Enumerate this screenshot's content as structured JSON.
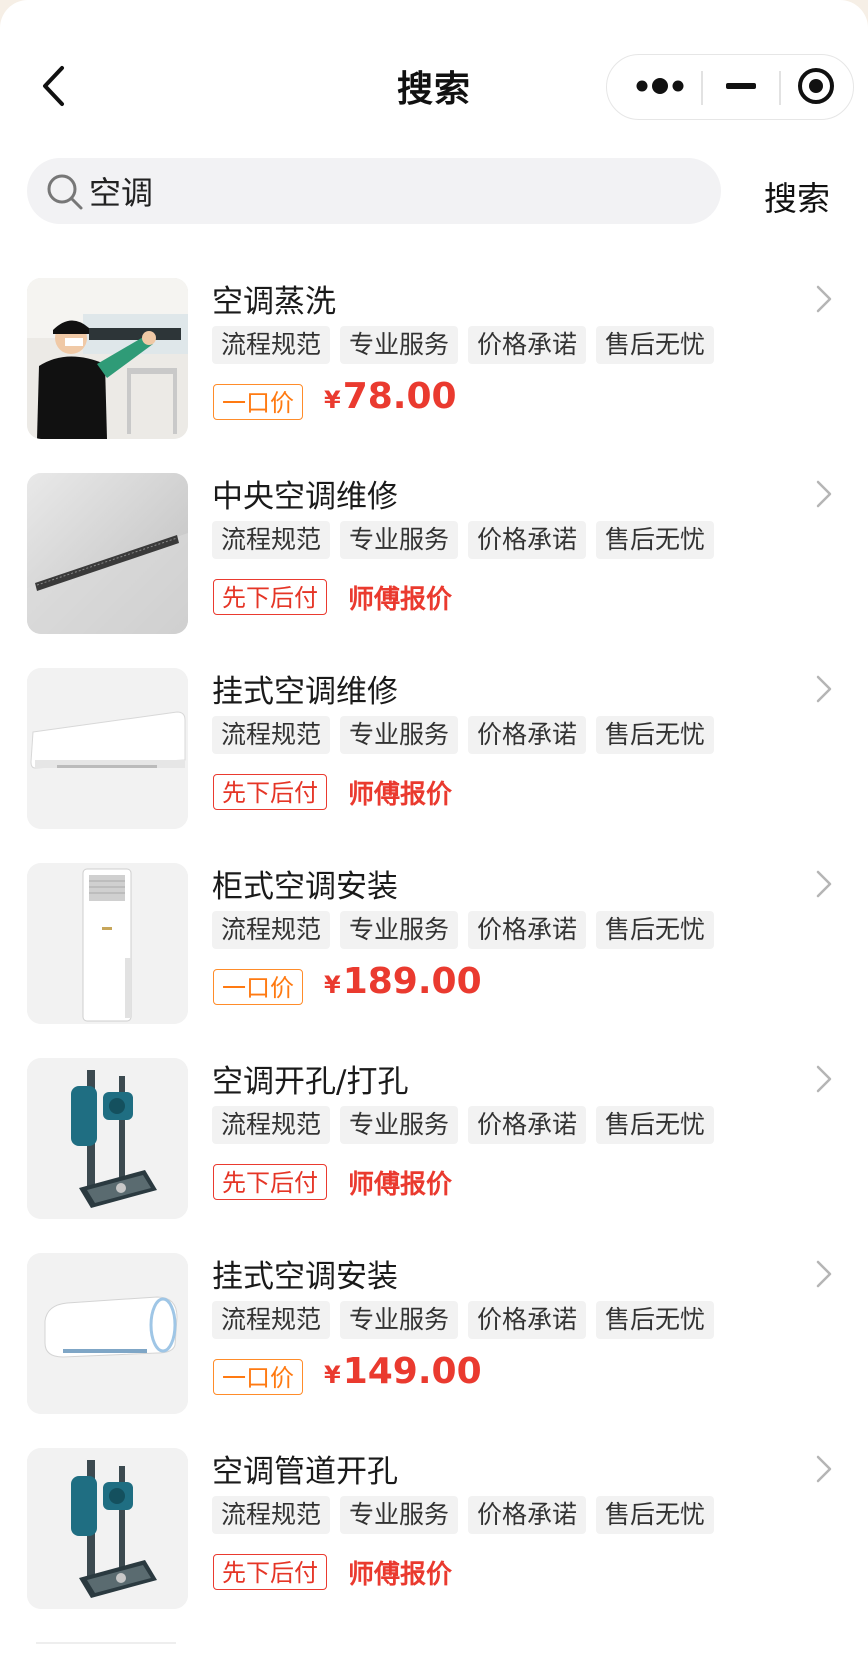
{
  "header": {
    "title": "搜索"
  },
  "search": {
    "value": "空调",
    "button_label": "搜索"
  },
  "colors": {
    "price_red": "#ea3a2f",
    "fixed_orange": "#ff7a12",
    "tag_bg": "#f2f2f2",
    "search_bg": "#f2f2f4"
  },
  "items": [
    {
      "title": "空调蒸洗",
      "tags": [
        "流程规范",
        "专业服务",
        "价格承诺",
        "售后无忧"
      ],
      "badge": "一口价",
      "badge_type": "fixed",
      "price_symbol": "¥",
      "price": "78.00",
      "quote": ""
    },
    {
      "title": "中央空调维修",
      "tags": [
        "流程规范",
        "专业服务",
        "价格承诺",
        "售后无忧"
      ],
      "badge": "先下后付",
      "badge_type": "later",
      "price_symbol": "",
      "price": "",
      "quote": "师傅报价"
    },
    {
      "title": "挂式空调维修",
      "tags": [
        "流程规范",
        "专业服务",
        "价格承诺",
        "售后无忧"
      ],
      "badge": "先下后付",
      "badge_type": "later",
      "price_symbol": "",
      "price": "",
      "quote": "师傅报价"
    },
    {
      "title": "柜式空调安装",
      "tags": [
        "流程规范",
        "专业服务",
        "价格承诺",
        "售后无忧"
      ],
      "badge": "一口价",
      "badge_type": "fixed",
      "price_symbol": "¥",
      "price": "189.00",
      "quote": ""
    },
    {
      "title": "空调开孔/打孔",
      "tags": [
        "流程规范",
        "专业服务",
        "价格承诺",
        "售后无忧"
      ],
      "badge": "先下后付",
      "badge_type": "later",
      "price_symbol": "",
      "price": "",
      "quote": "师傅报价"
    },
    {
      "title": "挂式空调安装",
      "tags": [
        "流程规范",
        "专业服务",
        "价格承诺",
        "售后无忧"
      ],
      "badge": "一口价",
      "badge_type": "fixed",
      "price_symbol": "¥",
      "price": "149.00",
      "quote": ""
    },
    {
      "title": "空调管道开孔",
      "tags": [
        "流程规范",
        "专业服务",
        "价格承诺",
        "售后无忧"
      ],
      "badge": "先下后付",
      "badge_type": "later",
      "price_symbol": "",
      "price": "",
      "quote": "师傅报价"
    }
  ]
}
